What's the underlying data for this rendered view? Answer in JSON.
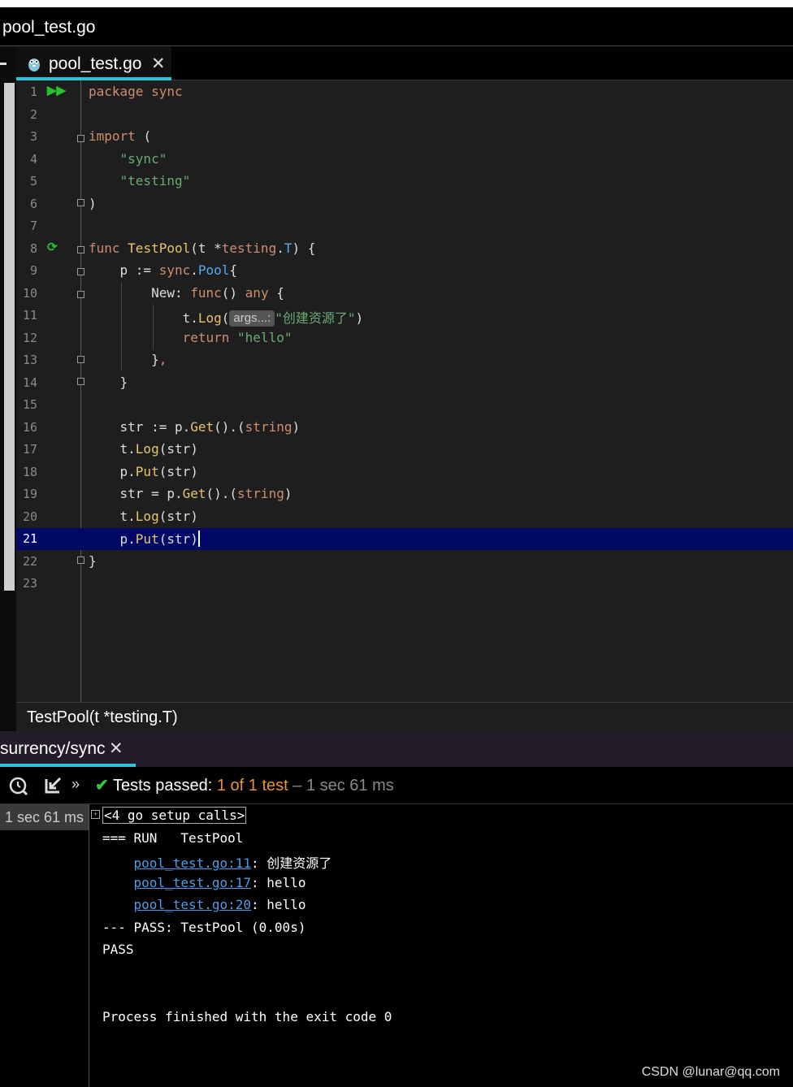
{
  "window": {
    "title": "pool_test.go"
  },
  "editor_tab": {
    "label": "pool_test.go",
    "close": "✕"
  },
  "code_lines": [
    {
      "n": "1"
    },
    {
      "n": "2"
    },
    {
      "n": "3"
    },
    {
      "n": "4"
    },
    {
      "n": "5"
    },
    {
      "n": "6"
    },
    {
      "n": "7"
    },
    {
      "n": "8"
    },
    {
      "n": "9"
    },
    {
      "n": "10"
    },
    {
      "n": "11"
    },
    {
      "n": "12"
    },
    {
      "n": "13"
    },
    {
      "n": "14"
    },
    {
      "n": "15"
    },
    {
      "n": "16"
    },
    {
      "n": "17"
    },
    {
      "n": "18"
    },
    {
      "n": "19"
    },
    {
      "n": "20"
    },
    {
      "n": "21"
    },
    {
      "n": "22"
    },
    {
      "n": "23"
    }
  ],
  "code": {
    "l1": {
      "kw": "package",
      "name": "sync"
    },
    "l3": {
      "kw": "import",
      "rest": "("
    },
    "l4": "\"sync\"",
    "l5": "\"testing\"",
    "l6": ")",
    "l8": {
      "kw": "func",
      "fn": "TestPool",
      "a": "(t *",
      "pkg": "testing",
      "dot": ".",
      "ty": "T",
      "b": ") {"
    },
    "l9": {
      "a": "p := ",
      "pkg": "sync",
      "dot": ".",
      "ty": "Pool",
      "b": "{"
    },
    "l10": {
      "a": "New: ",
      "kw": "func",
      "b": "() ",
      "kw2": "any",
      "c": " {"
    },
    "l11": {
      "a": "t.",
      "m": "Log",
      "b": "(",
      "hint": "args...:",
      "str": "\"创建资源了\"",
      "c": ")"
    },
    "l12": {
      "kw": "return",
      "str": "\"hello\""
    },
    "l13": {
      "a": "}",
      "b": ","
    },
    "l14": "}",
    "l16": {
      "a": "str := p.",
      "m": "Get",
      "b": "().(",
      "kw": "string",
      "c": ")"
    },
    "l17": {
      "a": "t.",
      "m": "Log",
      "b": "(str)"
    },
    "l18": {
      "a": "p.",
      "m": "Put",
      "b": "(str)"
    },
    "l19": {
      "a": "str = p.",
      "m": "Get",
      "b": "().(",
      "kw": "string",
      "c": ")"
    },
    "l20": {
      "a": "t.",
      "m": "Log",
      "b": "(str)"
    },
    "l21": {
      "a": "p.",
      "m": "Put",
      "b": "(str)"
    },
    "l22": "}"
  },
  "breadcrumb": "TestPool(t *testing.T)",
  "run_tab": {
    "label": "surrency/sync",
    "close": "✕"
  },
  "status": {
    "label": "Tests passed:",
    "count": "1",
    "of": "of",
    "total": "1 test",
    "dash": "–",
    "duration": "1 sec 61 ms"
  },
  "tree": {
    "duration": "1 sec 61 ms",
    "expander": "+"
  },
  "console": {
    "setup": "<4 go setup calls>",
    "run": "=== RUN   TestPool",
    "log1_link": "pool_test.go:11",
    "log1_text": ": 创建资源了",
    "log2_link": "pool_test.go:17",
    "log2_text": ": hello",
    "log3_link": "pool_test.go:20",
    "log3_text": ": hello",
    "pass_line": "--- PASS: TestPool (0.00s)",
    "pass": "PASS",
    "finished": "Process finished with the exit code 0"
  },
  "watermark": "CSDN @lunar@qq.com",
  "icons": [
    "run-all-icon",
    "run-rerun-icon",
    "history-icon",
    "import-tests-icon",
    "more-icon",
    "check-icon",
    "gopher-file-icon",
    "fold-icon"
  ],
  "colors": {
    "accent": "#2fc3d8",
    "pass": "#3ec43e",
    "current_line": "#000a66"
  }
}
